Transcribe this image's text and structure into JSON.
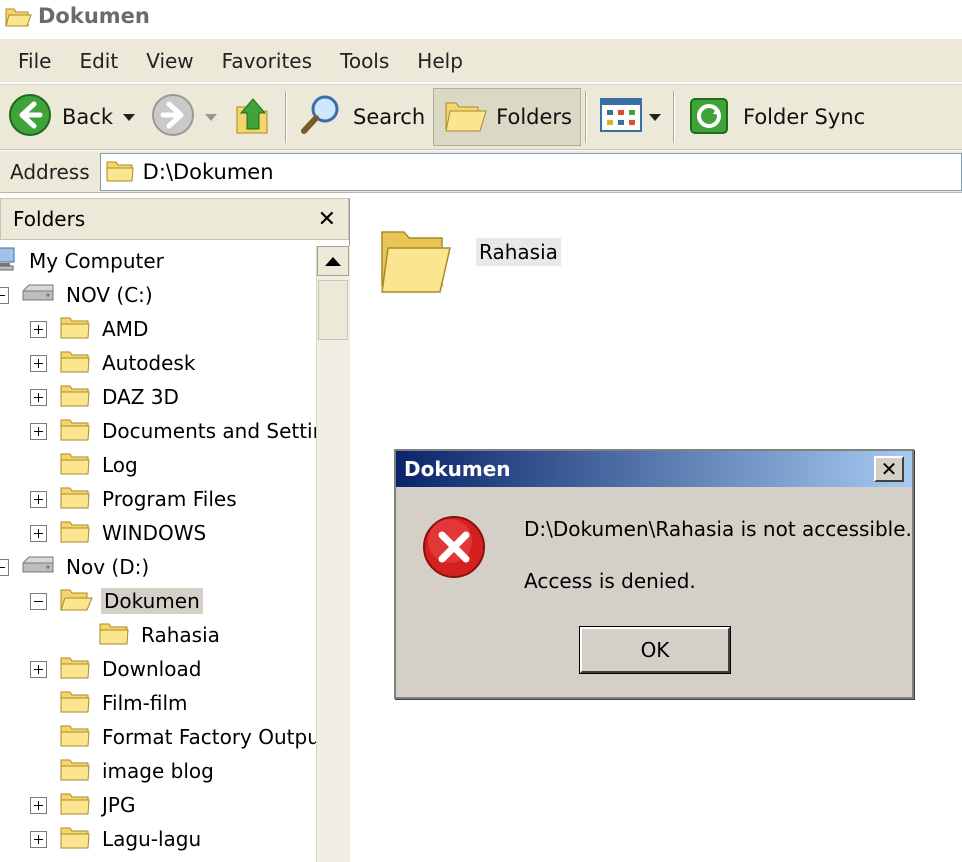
{
  "window": {
    "title": "Dokumen"
  },
  "menu": {
    "items": [
      "File",
      "Edit",
      "View",
      "Favorites",
      "Tools",
      "Help"
    ]
  },
  "toolbar": {
    "back_label": "Back",
    "search_label": "Search",
    "folders_label": "Folders",
    "folder_sync_label": "Folder Sync"
  },
  "address": {
    "label": "Address",
    "value": "D:\\Dokumen"
  },
  "folders_pane": {
    "title": "Folders",
    "close": "✕",
    "tree": [
      {
        "label": "My Computer",
        "kind": "computer",
        "level": 0
      },
      {
        "label": "NOV (C:)",
        "kind": "drive",
        "level": 1,
        "expander": "minus"
      },
      {
        "label": "AMD",
        "kind": "folder",
        "level": 2,
        "expander": "plus"
      },
      {
        "label": "Autodesk",
        "kind": "folder",
        "level": 2,
        "expander": "plus"
      },
      {
        "label": "DAZ 3D",
        "kind": "folder",
        "level": 2,
        "expander": "plus"
      },
      {
        "label": "Documents and Settin",
        "kind": "folder",
        "level": 2,
        "expander": "plus"
      },
      {
        "label": "Log",
        "kind": "folder",
        "level": 2,
        "expander": "none"
      },
      {
        "label": "Program Files",
        "kind": "folder",
        "level": 2,
        "expander": "plus"
      },
      {
        "label": "WINDOWS",
        "kind": "folder",
        "level": 2,
        "expander": "plus"
      },
      {
        "label": "Nov (D:)",
        "kind": "drive",
        "level": 1,
        "expander": "minus"
      },
      {
        "label": "Dokumen",
        "kind": "folder-open",
        "level": 2,
        "expander": "minus",
        "selected": true
      },
      {
        "label": "Rahasia",
        "kind": "folder",
        "level": 3,
        "expander": "none"
      },
      {
        "label": "Download",
        "kind": "folder",
        "level": 2,
        "expander": "plus"
      },
      {
        "label": "Film-film",
        "kind": "folder",
        "level": 2,
        "expander": "none"
      },
      {
        "label": "Format Factory Outpu",
        "kind": "folder",
        "level": 2,
        "expander": "none"
      },
      {
        "label": "image blog",
        "kind": "folder",
        "level": 2,
        "expander": "none"
      },
      {
        "label": "JPG",
        "kind": "folder",
        "level": 2,
        "expander": "plus"
      },
      {
        "label": "Lagu-lagu",
        "kind": "folder",
        "level": 2,
        "expander": "plus"
      }
    ]
  },
  "content": {
    "items": [
      {
        "label": "Rahasia",
        "icon": "folder-icon"
      }
    ]
  },
  "dialog": {
    "title": "Dokumen",
    "close": "✕",
    "message": "D:\\Dokumen\\Rahasia is not accessible.",
    "detail": "Access is denied.",
    "ok_label": "OK",
    "icon": "error-icon"
  }
}
